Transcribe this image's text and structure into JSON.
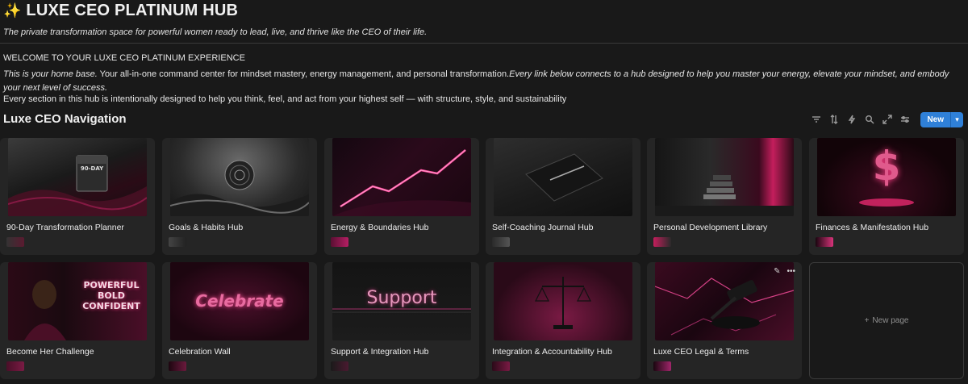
{
  "header": {
    "emoji": "✨",
    "title": "LUXE CEO PLATINUM HUB",
    "subtitle": "The private transformation space for powerful women ready to lead, live, and thrive like the CEO of their life."
  },
  "intro": {
    "welcome": "WELCOME TO YOUR LUXE CEO PLATINUM EXPERIENCE",
    "line1_italic": "This is your home base.",
    "line1_regular": " Your all-in-one command center for mindset mastery, energy management, and personal transformation.",
    "line1_italic2": "Every link below connects to a hub designed to help you master your energy, elevate your mindset, and embody your next level of success.",
    "line3": "Every section in this hub is intentionally designed to help you think, feel, and act from your highest self — with structure, style, and sustainability"
  },
  "nav": {
    "title": "Luxe CEO Navigation",
    "toolbar_icons": [
      "filter-icon",
      "sort-icon",
      "lightning-icon",
      "search-icon",
      "expand-icon",
      "settings-sliders-icon"
    ],
    "new_label": "New",
    "new_page_label": "New page"
  },
  "cards": [
    {
      "label": "90-Day Transformation Planner",
      "image_text": "90-DAY",
      "theme": "calendar"
    },
    {
      "label": "Goals & Habits Hub",
      "image_text": "",
      "theme": "target"
    },
    {
      "label": "Energy & Boundaries Hub",
      "image_text": "",
      "theme": "lightning"
    },
    {
      "label": "Self-Coaching Journal Hub",
      "image_text": "",
      "theme": "journal"
    },
    {
      "label": "Personal Development Library",
      "image_text": "",
      "theme": "books"
    },
    {
      "label": "Finances & Manifestation Hub",
      "image_text": "$",
      "theme": "dollar"
    },
    {
      "label": "Become Her Challenge",
      "image_text": "POWERFUL BOLD CONFIDENT",
      "theme": "woman"
    },
    {
      "label": "Celebration Wall",
      "image_text": "Celebrate",
      "theme": "celebrate"
    },
    {
      "label": "Support & Integration Hub",
      "image_text": "Support",
      "theme": "support"
    },
    {
      "label": "Integration & Accountability Hub",
      "image_text": "",
      "theme": "scales"
    },
    {
      "label": "Luxe CEO Legal & Terms",
      "image_text": "",
      "theme": "gavel"
    }
  ],
  "colors": {
    "background": "#191919",
    "card": "#252525",
    "accent_pink": "#e0246e",
    "button_blue": "#2f80d8"
  }
}
